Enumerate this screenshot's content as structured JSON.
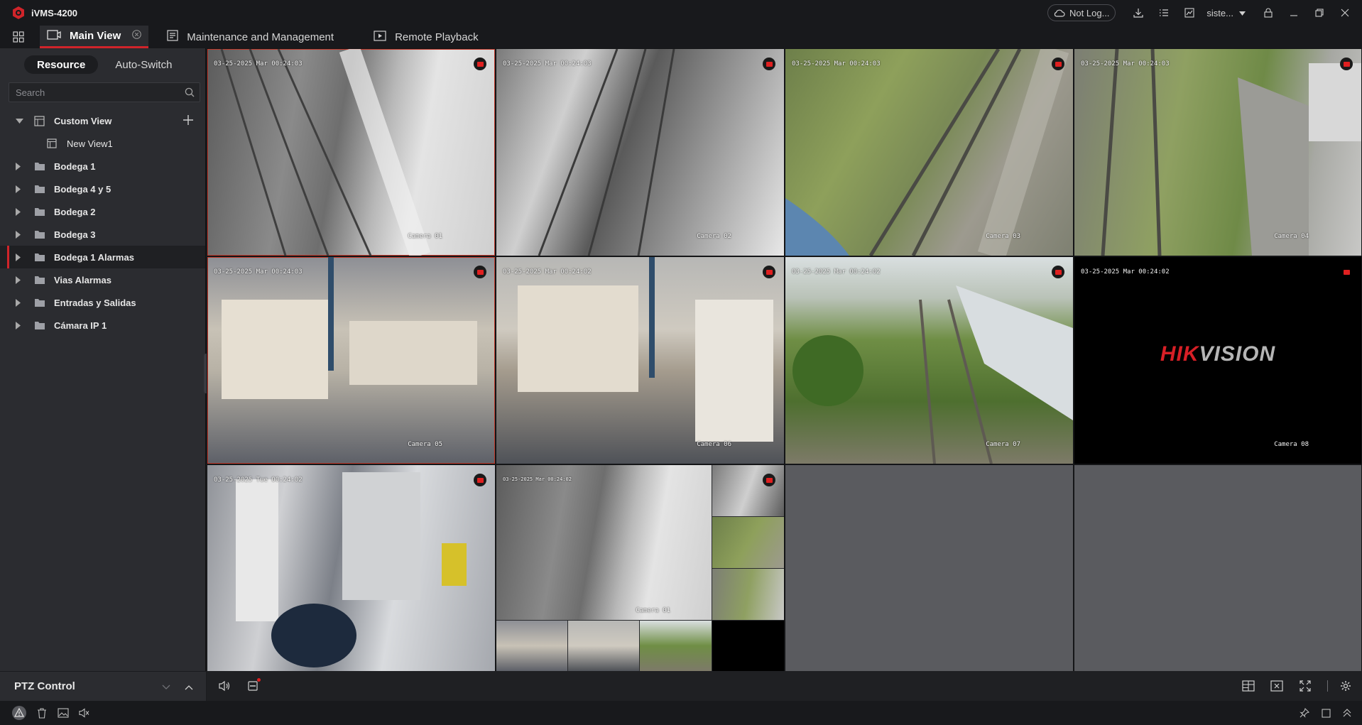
{
  "app": {
    "title": "iVMS-4200"
  },
  "titlebar": {
    "login_label": "Not Log...",
    "user_label": "siste..."
  },
  "tabs": [
    {
      "label": "Main View"
    },
    {
      "label": "Maintenance and Management"
    },
    {
      "label": "Remote Playback"
    }
  ],
  "sidebar": {
    "segments": {
      "resource": "Resource",
      "auto_switch": "Auto-Switch"
    },
    "search": {
      "placeholder": "Search"
    },
    "tree": [
      {
        "label": "Custom View",
        "expanded": true,
        "icon": "view-icon"
      },
      {
        "label": "New View1",
        "child": true,
        "icon": "view-icon"
      },
      {
        "label": "Bodega 1",
        "icon": "folder-icon"
      },
      {
        "label": "Bodega 4 y 5",
        "icon": "folder-icon"
      },
      {
        "label": "Bodega 2",
        "icon": "folder-icon"
      },
      {
        "label": "Bodega 3",
        "icon": "folder-icon"
      },
      {
        "label": "Bodega 1 Alarmas",
        "icon": "folder-icon",
        "selected": true
      },
      {
        "label": "Vias Alarmas",
        "icon": "folder-icon"
      },
      {
        "label": "Entradas y Salidas",
        "icon": "folder-icon"
      },
      {
        "label": "Cámara IP 1",
        "icon": "folder-icon"
      }
    ],
    "ptz_label": "PTZ Control"
  },
  "cameras": [
    {
      "time": "03-25-2025 Mar  00:24:03",
      "name": "Camera 01",
      "scene": "warehouse-bw",
      "recording": true
    },
    {
      "time": "03-25-2025 Mar  00:24:03",
      "name": "Camera 02",
      "scene": "warehouse-bw",
      "recording": true
    },
    {
      "time": "03-25-2025 Mar  00:24:03",
      "name": "Camera 03",
      "scene": "rail-green",
      "recording": true
    },
    {
      "time": "03-25-2025 Mar  00:24:03",
      "name": "Camera 04",
      "scene": "rail-green",
      "recording": true
    },
    {
      "time": "03-25-2025 Mar  00:24:03",
      "name": "Camera 05",
      "scene": "bags-color",
      "recording": true
    },
    {
      "time": "03-25-2025 Mar  00:24:02",
      "name": "Camera 06",
      "scene": "bags-color",
      "recording": true
    },
    {
      "time": "03-25-2025 Mar  00:24:02",
      "name": "Camera 07",
      "scene": "rail-field",
      "recording": true
    },
    {
      "time": "03-25-2025 Mar  00:24:02",
      "name": "Camera 08",
      "scene": "no-signal",
      "recording": true,
      "logo_left": "HIK",
      "logo_right": "VISION"
    },
    {
      "time": "03-25-2025 Tue  00:24:02",
      "name": "",
      "scene": "office",
      "recording": true
    },
    {
      "time": "03-25-2025 Mar  00:24:02",
      "name": "Camera 01",
      "scene": "mosaic",
      "recording": true
    }
  ],
  "colors": {
    "accent": "#d0242a",
    "background": "#1c1d20",
    "panel": "#2b2c30",
    "empty_tile": "#5a5b5f"
  }
}
